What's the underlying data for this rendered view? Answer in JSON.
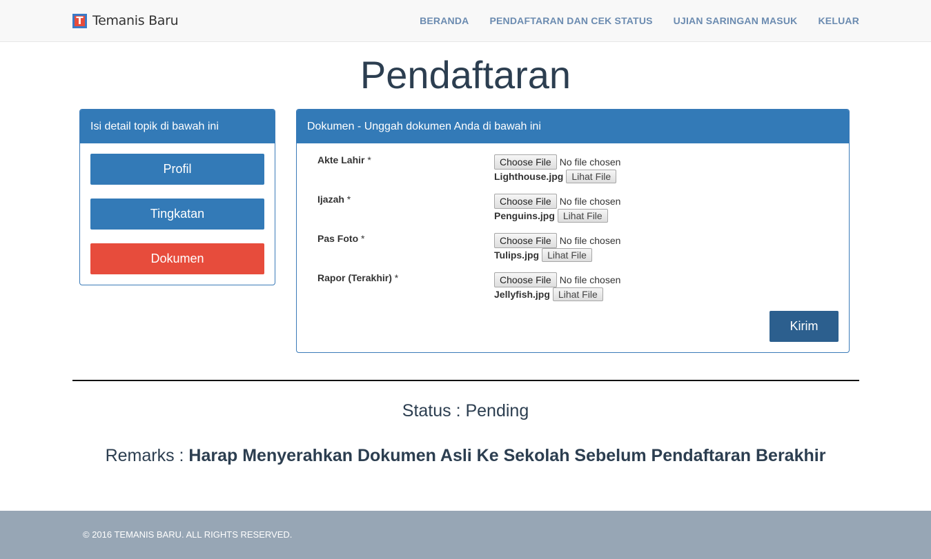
{
  "navbar": {
    "brand": "Temanis Baru",
    "links": [
      "BERANDA",
      "PENDAFTARAN DAN CEK STATUS",
      "UJIAN SARINGAN MASUK",
      "KELUAR"
    ]
  },
  "page_title": "Pendaftaran",
  "sidebar": {
    "heading": "Isi detail topik di bawah ini",
    "buttons": [
      "Profil",
      "Tingkatan",
      "Dokumen"
    ]
  },
  "documents": {
    "heading": "Dokumen - Unggah dokumen Anda di bawah ini",
    "choose_label": "Choose File",
    "no_file_label": "No file chosen",
    "view_label": "Lihat File",
    "required_mark": "*",
    "rows": [
      {
        "label": "Akte Lahir",
        "file": "Lighthouse.jpg"
      },
      {
        "label": "Ijazah",
        "file": "Penguins.jpg"
      },
      {
        "label": "Pas Foto",
        "file": "Tulips.jpg"
      },
      {
        "label": "Rapor (Terakhir)",
        "file": "Jellyfish.jpg"
      }
    ],
    "submit_label": "Kirim"
  },
  "status": {
    "text": "Status : Pending"
  },
  "remarks": {
    "prefix": "Remarks :",
    "text": "Harap Menyerahkan Dokumen Asli Ke Sekolah Sebelum Pendaftaran Berakhir"
  },
  "footer": {
    "copyright": "© 2016 TEMANIS BARU. ALL RIGHTS RESERVED."
  },
  "colors": {
    "primary": "#337ab7",
    "danger": "#e74c3c",
    "submit": "#2c5f8e",
    "footer": "#97a6b5",
    "nav_link": "#6b8bb0"
  }
}
